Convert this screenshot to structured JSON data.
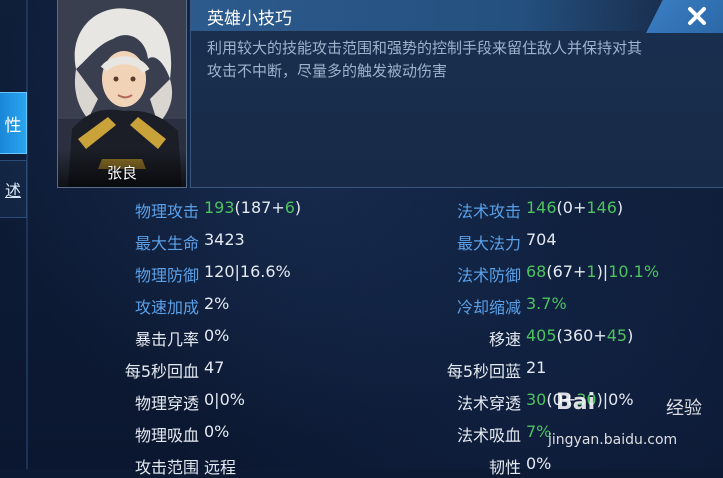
{
  "hero": {
    "name": "张良"
  },
  "side_tabs": {
    "active": "性",
    "other": "述"
  },
  "tips": {
    "title": "英雄小技巧",
    "body": "利用较大的技能攻击范围和强势的控制手段来留住敌人并保持对其攻击不中断，尽量多的触发被动伤害"
  },
  "stats_left": [
    {
      "label": "物理攻击",
      "label_color": "blue",
      "parts": [
        {
          "t": "193",
          "c": "grn"
        },
        {
          "t": "(187+",
          "c": "val"
        },
        {
          "t": "6",
          "c": "grn"
        },
        {
          "t": ")",
          "c": "val"
        }
      ]
    },
    {
      "label": "最大生命",
      "label_color": "blue",
      "parts": [
        {
          "t": "3423",
          "c": "val"
        }
      ]
    },
    {
      "label": "物理防御",
      "label_color": "blue",
      "parts": [
        {
          "t": "120|16.6%",
          "c": "val"
        }
      ]
    },
    {
      "label": "攻速加成",
      "label_color": "blue",
      "parts": [
        {
          "t": "2%",
          "c": "val"
        }
      ]
    },
    {
      "label": "暴击几率",
      "label_color": "white",
      "parts": [
        {
          "t": "0%",
          "c": "val"
        }
      ]
    },
    {
      "label": "每5秒回血",
      "label_color": "white",
      "parts": [
        {
          "t": "47",
          "c": "val"
        }
      ]
    },
    {
      "label": "物理穿透",
      "label_color": "white",
      "parts": [
        {
          "t": "0|0%",
          "c": "val"
        }
      ]
    },
    {
      "label": "物理吸血",
      "label_color": "white",
      "parts": [
        {
          "t": "0%",
          "c": "val"
        }
      ]
    },
    {
      "label": "攻击范围",
      "label_color": "white",
      "parts": [
        {
          "t": "远程",
          "c": "val"
        }
      ]
    }
  ],
  "stats_right": [
    {
      "label": "法术攻击",
      "label_color": "blue",
      "parts": [
        {
          "t": "146",
          "c": "grn"
        },
        {
          "t": "(0+",
          "c": "val"
        },
        {
          "t": "146",
          "c": "grn"
        },
        {
          "t": ")",
          "c": "val"
        }
      ]
    },
    {
      "label": "最大法力",
      "label_color": "blue",
      "parts": [
        {
          "t": "704",
          "c": "val"
        }
      ]
    },
    {
      "label": "法术防御",
      "label_color": "blue",
      "parts": [
        {
          "t": "68",
          "c": "grn"
        },
        {
          "t": "(67+",
          "c": "val"
        },
        {
          "t": "1",
          "c": "grn"
        },
        {
          "t": ")|",
          "c": "val"
        },
        {
          "t": "10.1%",
          "c": "grn"
        }
      ]
    },
    {
      "label": "冷却缩减",
      "label_color": "blue",
      "parts": [
        {
          "t": "3.7%",
          "c": "grn"
        }
      ]
    },
    {
      "label": "移速",
      "label_color": "white",
      "parts": [
        {
          "t": "405",
          "c": "grn"
        },
        {
          "t": "(360+",
          "c": "val"
        },
        {
          "t": "45",
          "c": "grn"
        },
        {
          "t": ")",
          "c": "val"
        }
      ]
    },
    {
      "label": "每5秒回蓝",
      "label_color": "white",
      "parts": [
        {
          "t": "21",
          "c": "val"
        }
      ]
    },
    {
      "label": "法术穿透",
      "label_color": "white",
      "parts": [
        {
          "t": "30",
          "c": "grn"
        },
        {
          "t": "(0+",
          "c": "val"
        },
        {
          "t": "30",
          "c": "grn"
        },
        {
          "t": ")|0%",
          "c": "val"
        }
      ]
    },
    {
      "label": "法术吸血",
      "label_color": "white",
      "parts": [
        {
          "t": "7%",
          "c": "grn"
        }
      ]
    },
    {
      "label": "韧性",
      "label_color": "white",
      "parts": [
        {
          "t": "0%",
          "c": "val"
        }
      ]
    }
  ],
  "watermark": {
    "logo": "Bai",
    "text": "经验",
    "url": "jingyan.baidu.com"
  },
  "colors": {
    "accent_blue": "#5aa0e8",
    "value_green": "#4ec25f",
    "panel": "#172a47"
  }
}
